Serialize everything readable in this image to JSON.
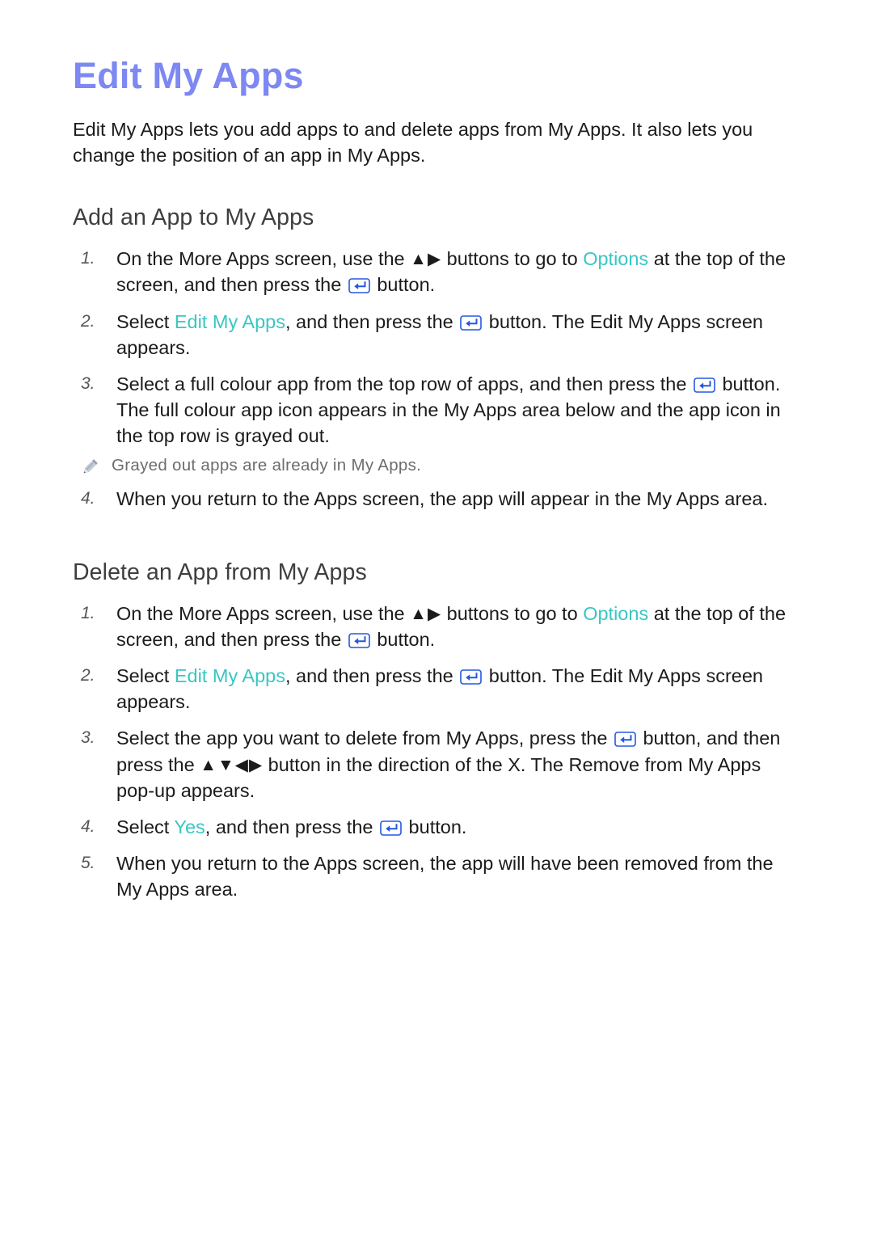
{
  "page": {
    "title": "Edit My Apps",
    "intro": "Edit My Apps lets you add apps to and delete apps from My Apps. It also lets you change the position of an app in My Apps."
  },
  "colors": {
    "title": "#7d88f2",
    "highlight": "#3ac6c2",
    "heading": "#3e3e3e",
    "body": "#1b1b1b",
    "note": "#6d6d6d",
    "enter_key": "#2558e0"
  },
  "icons": {
    "enter_button": "enter-key-icon",
    "pencil": "pencil-icon",
    "arrow_up": "▲",
    "arrow_down": "▼",
    "arrow_left": "◀",
    "arrow_right": "▶"
  },
  "sections": [
    {
      "heading": "Add an App to My Apps",
      "steps": [
        {
          "num": "1.",
          "parts": [
            {
              "t": "text",
              "v": "On the More Apps screen, use the "
            },
            {
              "t": "arrows",
              "v": "▲▶"
            },
            {
              "t": "text",
              "v": " buttons to go to "
            },
            {
              "t": "hl",
              "v": "Options"
            },
            {
              "t": "text",
              "v": " at the top of the screen, and then press the "
            },
            {
              "t": "enter",
              "v": ""
            },
            {
              "t": "text",
              "v": " button."
            }
          ]
        },
        {
          "num": "2.",
          "parts": [
            {
              "t": "text",
              "v": "Select "
            },
            {
              "t": "hl",
              "v": "Edit My Apps"
            },
            {
              "t": "text",
              "v": ", and then press the "
            },
            {
              "t": "enter",
              "v": ""
            },
            {
              "t": "text",
              "v": " button. The Edit My Apps screen appears."
            }
          ]
        },
        {
          "num": "3.",
          "parts": [
            {
              "t": "text",
              "v": "Select a full colour app from the top row of apps, and then press the "
            },
            {
              "t": "enter",
              "v": ""
            },
            {
              "t": "text",
              "v": " button. The full colour app icon appears in the My Apps area below and the app icon in the top row is grayed out."
            }
          ]
        }
      ],
      "note_after_step": 3,
      "note": "Grayed out apps are already in My Apps.",
      "steps_after_note": [
        {
          "num": "4.",
          "parts": [
            {
              "t": "text",
              "v": "When you return to the Apps screen, the app will appear in the My Apps area."
            }
          ]
        }
      ]
    },
    {
      "heading": "Delete an App from My Apps",
      "steps": [
        {
          "num": "1.",
          "parts": [
            {
              "t": "text",
              "v": "On the More Apps screen, use the "
            },
            {
              "t": "arrows",
              "v": "▲▶"
            },
            {
              "t": "text",
              "v": " buttons to go to "
            },
            {
              "t": "hl",
              "v": "Options"
            },
            {
              "t": "text",
              "v": " at the top of the screen, and then press the "
            },
            {
              "t": "enter",
              "v": ""
            },
            {
              "t": "text",
              "v": " button."
            }
          ]
        },
        {
          "num": "2.",
          "parts": [
            {
              "t": "text",
              "v": "Select "
            },
            {
              "t": "hl",
              "v": "Edit My Apps"
            },
            {
              "t": "text",
              "v": ", and then press the "
            },
            {
              "t": "enter",
              "v": ""
            },
            {
              "t": "text",
              "v": " button. The Edit My Apps screen appears."
            }
          ]
        },
        {
          "num": "3.",
          "parts": [
            {
              "t": "text",
              "v": "Select the app you want to delete from My Apps, press the "
            },
            {
              "t": "enter",
              "v": ""
            },
            {
              "t": "text",
              "v": " button, and then press the "
            },
            {
              "t": "arrows",
              "v": "▲▼◀▶"
            },
            {
              "t": "text",
              "v": " button in the direction of the X. The Remove from My Apps pop-up appears."
            }
          ]
        },
        {
          "num": "4.",
          "parts": [
            {
              "t": "text",
              "v": "Select "
            },
            {
              "t": "hl",
              "v": "Yes"
            },
            {
              "t": "text",
              "v": ", and then press the "
            },
            {
              "t": "enter",
              "v": ""
            },
            {
              "t": "text",
              "v": " button."
            }
          ]
        },
        {
          "num": "5.",
          "parts": [
            {
              "t": "text",
              "v": "When you return to the Apps screen, the app will have been removed from the My Apps area."
            }
          ]
        }
      ],
      "note_after_step": null,
      "note": null,
      "steps_after_note": []
    }
  ]
}
